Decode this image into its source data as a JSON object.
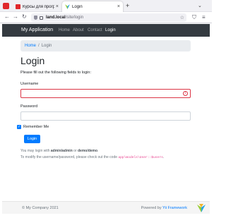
{
  "browser": {
    "tabs": [
      {
        "label": "Курсы для программи…",
        "close": "×"
      },
      {
        "label": "Login",
        "close": "×"
      }
    ],
    "new_tab": "+",
    "nav": {
      "back": "←",
      "forward": "→",
      "reload": "↻"
    },
    "url_host": "land.local",
    "url_path": "/site/login",
    "star": "☆",
    "tools": [
      "⛉",
      "≡"
    ]
  },
  "navbar": {
    "brand": "My Application",
    "links": [
      {
        "label": "Home"
      },
      {
        "label": "About"
      },
      {
        "label": "Contact"
      },
      {
        "label": "Login"
      }
    ]
  },
  "breadcrumb": {
    "home": "Home",
    "separator": "/",
    "active": "Login"
  },
  "page": {
    "title": "Login",
    "intro": "Please fill out the following fields to login:"
  },
  "form": {
    "username_label": "Username",
    "username_value": "",
    "password_label": "Password",
    "password_value": "",
    "remember_label": "Remember Me",
    "submit_label": "Login",
    "error_icon": "!"
  },
  "hints": {
    "line1_prefix": "You may login with ",
    "line1_user1": "admin/admin",
    "line1_or": " or ",
    "line1_user2": "demo/demo",
    "line1_suffix": ".",
    "line2_prefix": "To modify the username/password, please check out the code ",
    "line2_code": "app\\models\\User::$users",
    "line2_suffix": "."
  },
  "footer": {
    "copyright": "© My Company 2021",
    "powered_prefix": "Powered by ",
    "powered_link": "Yii Framework"
  },
  "colors": {
    "navbar_bg": "#343a40",
    "primary": "#007bff",
    "danger": "#dc3545",
    "code": "#e83e8c"
  }
}
